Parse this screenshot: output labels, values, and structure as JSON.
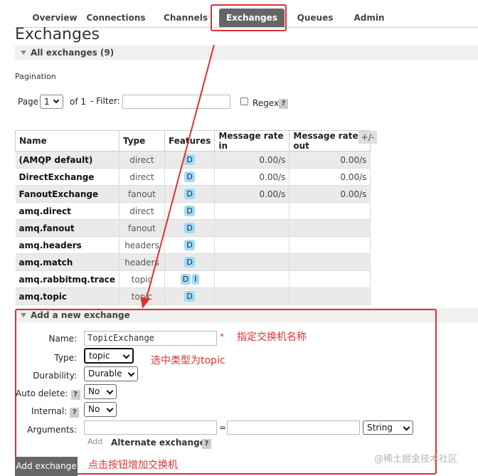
{
  "nav": {
    "tabs": [
      "Overview",
      "Connections",
      "Channels",
      "Exchanges",
      "Queues",
      "Admin"
    ],
    "active": "Exchanges"
  },
  "page_title": "Exchanges",
  "all_exchanges": {
    "label": "All exchanges (9)"
  },
  "pagination": {
    "title": "Pagination",
    "page_label": "Page",
    "page_value": "1",
    "of_label": "of 1",
    "filter_label": "- Filter:",
    "filter_value": "",
    "regex_label": "Regex",
    "help": "?"
  },
  "table": {
    "headers": [
      "Name",
      "Type",
      "Features",
      "Message rate in",
      "Message rate out"
    ],
    "plus_minus": "+/-",
    "rows": [
      {
        "name": "(AMQP default)",
        "type": "direct",
        "features": [
          "D"
        ],
        "rate_in": "0.00/s",
        "rate_out": "0.00/s"
      },
      {
        "name": "DirectExchange",
        "type": "direct",
        "features": [
          "D"
        ],
        "rate_in": "0.00/s",
        "rate_out": "0.00/s"
      },
      {
        "name": "FanoutExchange",
        "type": "fanout",
        "features": [
          "D"
        ],
        "rate_in": "0.00/s",
        "rate_out": "0.00/s"
      },
      {
        "name": "amq.direct",
        "type": "direct",
        "features": [
          "D"
        ],
        "rate_in": "",
        "rate_out": ""
      },
      {
        "name": "amq.fanout",
        "type": "fanout",
        "features": [
          "D"
        ],
        "rate_in": "",
        "rate_out": ""
      },
      {
        "name": "amq.headers",
        "type": "headers",
        "features": [
          "D"
        ],
        "rate_in": "",
        "rate_out": ""
      },
      {
        "name": "amq.match",
        "type": "headers",
        "features": [
          "D"
        ],
        "rate_in": "",
        "rate_out": ""
      },
      {
        "name": "amq.rabbitmq.trace",
        "type": "topic",
        "features": [
          "D",
          "I"
        ],
        "rate_in": "",
        "rate_out": ""
      },
      {
        "name": "amq.topic",
        "type": "topic",
        "features": [
          "D"
        ],
        "rate_in": "",
        "rate_out": ""
      }
    ]
  },
  "add_exchange": {
    "title": "Add a new exchange",
    "name_label": "Name:",
    "name_value": "TopicExchange",
    "required": "*",
    "type_label": "Type:",
    "type_value": "topic",
    "durability_label": "Durability:",
    "durability_value": "Durable",
    "auto_delete_label": "Auto delete:",
    "auto_delete_value": "No",
    "internal_label": "Internal:",
    "internal_value": "No",
    "arguments_label": "Arguments:",
    "arg_key": "",
    "arg_value": "",
    "arg_type": "String",
    "equals": "=",
    "add_link": "Add",
    "alternate_label": "Alternate exchange",
    "submit": "Add exchange"
  },
  "annotations": {
    "name_note": "指定交换机名称",
    "type_note": "选中类型为topic",
    "button_note": "点击按钮增加交换机"
  },
  "watermark": "@稀土掘金技术社区",
  "colors": {
    "annotation": "#e03030",
    "feature_badge": "#9fdcf5",
    "active_tab": "#666666"
  }
}
